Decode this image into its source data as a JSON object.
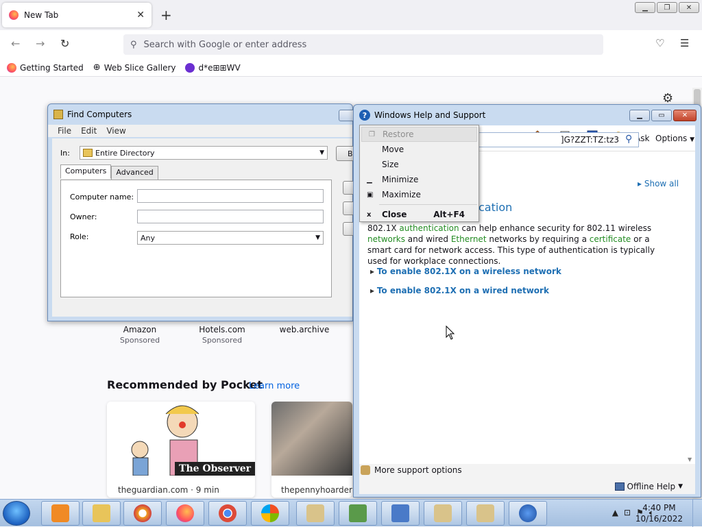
{
  "browser": {
    "tab_title": "New Tab",
    "urlbar_placeholder": "Search with Google or enter address",
    "bookmarks": [
      "Getting Started",
      "Web Slice Gallery",
      "d*e⊞⊞WV"
    ]
  },
  "newtab": {
    "top_sites": [
      {
        "name": "Amazon",
        "sponsored": "Sponsored"
      },
      {
        "name": "Hotels.com",
        "sponsored": "Sponsored"
      },
      {
        "name": "web.archive",
        "sponsored": ""
      }
    ],
    "pocket_title": "Recommended by Pocket",
    "pocket_learn_more": "Learn more",
    "cards": [
      {
        "source": "theguardian.com · 9 min",
        "badge": "The Observer"
      },
      {
        "source": "thepennyhoarder."
      }
    ]
  },
  "find_computers": {
    "title": "Find Computers",
    "menu": [
      "File",
      "Edit",
      "View"
    ],
    "in_label": "In:",
    "in_value": "Entire Directory",
    "side_button": "B",
    "tabs": [
      "Computers",
      "Advanced"
    ],
    "computer_name_label": "Computer name:",
    "owner_label": "Owner:",
    "role_label": "Role:",
    "role_value": "Any"
  },
  "help": {
    "title": "Windows Help and Support",
    "ask": "Ask",
    "options": "Options",
    "search_value": "]G?ZZT:TZ:tz3",
    "show_all": "Show all",
    "heading_fragment": "cation",
    "paragraph": [
      {
        "t": "802.1X ",
        "hl": false
      },
      {
        "t": "authentication",
        "hl": true
      },
      {
        "t": " can help enhance security for 802.11 wireless ",
        "hl": false
      },
      {
        "t": "networks",
        "hl": true
      },
      {
        "t": " and wired ",
        "hl": false
      },
      {
        "t": "Ethernet",
        "hl": true
      },
      {
        "t": " networks by requiring a ",
        "hl": false
      },
      {
        "t": "certificate",
        "hl": true
      },
      {
        "t": " or a smart card for network access. This type of authentication is typically used for workplace connections.",
        "hl": false
      }
    ],
    "link_wireless": "To enable 802.1X on a wireless network",
    "link_wired": "To enable 802.1X on a wired network",
    "more_support": "More support options",
    "offline_help": "Offline Help"
  },
  "context_menu": {
    "restore": "Restore",
    "move": "Move",
    "size": "Size",
    "minimize": "Minimize",
    "maximize": "Maximize",
    "close": "Close",
    "close_accel": "Alt+F4"
  },
  "taskbar": {
    "time": "4:40 PM",
    "date": "10/16/2022"
  },
  "colors": {
    "link_blue": "#1e6fb3",
    "highlight_green": "#228b22",
    "pocket_link": "#0061e0"
  }
}
